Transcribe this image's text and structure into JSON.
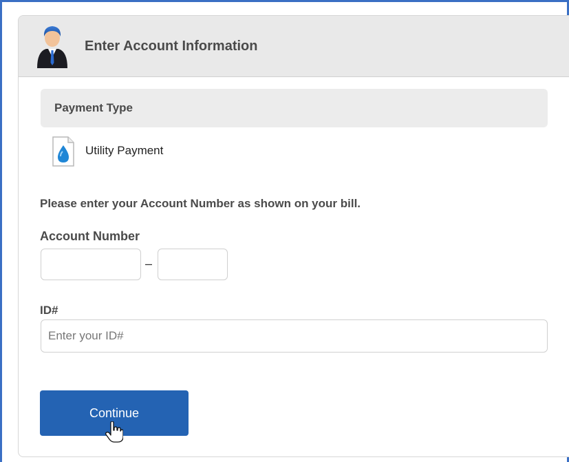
{
  "header": {
    "title": "Enter Account Information",
    "avatar_icon": "business-person-icon"
  },
  "payment_type": {
    "section_title": "Payment Type",
    "item_label": "Utility Payment",
    "item_icon": "water-drop-document-icon"
  },
  "form": {
    "instructions": "Please enter your Account Number as shown on your bill.",
    "account_number_label": "Account Number",
    "account_part1_value": "",
    "account_separator": "–",
    "account_part2_value": "",
    "id_label": "ID#",
    "id_placeholder": "Enter your ID#",
    "id_value": ""
  },
  "actions": {
    "continue_label": "Continue"
  },
  "colors": {
    "accent": "#2463b3",
    "frame_border": "#3a6fc4",
    "header_bg": "#e9e9e9"
  }
}
